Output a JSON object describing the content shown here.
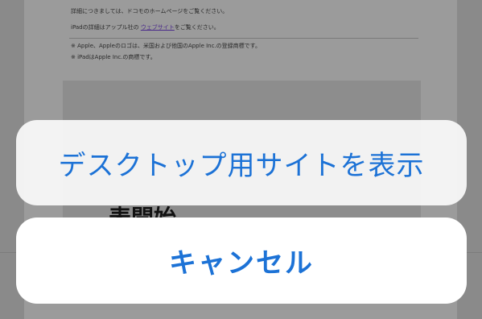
{
  "background_page": {
    "line1": "詳細につきましては、ドコモのホームページをご覧ください。",
    "line2_prefix": "iPadの詳細はアップル社の ",
    "line2_link": "ウェブサイト",
    "line2_suffix": "をご覧ください。",
    "note1": "※ Apple、Appleのロゴは、米国および他国のApple Inc.の登録商標です。",
    "note2": "※ iPadはApple Inc.の商標です。",
    "heading": "表開始"
  },
  "action_sheet": {
    "desktop_site_label": "デスクトップ用サイトを表示",
    "cancel_label": "キャンセル"
  },
  "colors": {
    "action_text": "#1c72d6",
    "dim_overlay": "#8a8a8a"
  }
}
